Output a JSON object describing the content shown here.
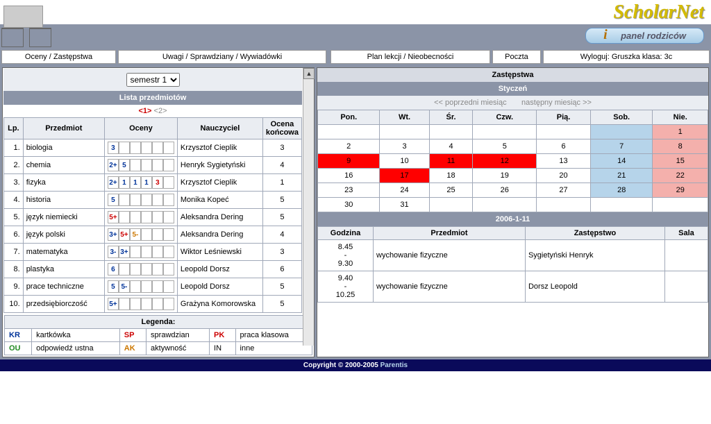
{
  "brand": {
    "name": "ScholarNet",
    "subtitle": "panel rodziców"
  },
  "nav": {
    "grades": "Oceny / Zastępstwa",
    "notes": "Uwagi / Sprawdziany / Wywiadówki",
    "plan": "Plan lekcji / Nieobecności",
    "mail": "Poczta",
    "logout": "Wyloguj: Gruszka klasa: 3c"
  },
  "left": {
    "semester_label": "semestr 1",
    "list_title": "Lista przedmiotów",
    "pager_active": "<1>",
    "pager_inactive": "<2>",
    "headers": {
      "lp": "Lp.",
      "subject": "Przedmiot",
      "grades": "Oceny",
      "teacher": "Nauczyciel",
      "final": "Ocena końcowa"
    },
    "rows": [
      {
        "lp": "1.",
        "subject": "biologia",
        "grades": [
          {
            "v": "3",
            "c": "blue"
          }
        ],
        "teacher": "Krzysztof Cieplik",
        "final": "3"
      },
      {
        "lp": "2.",
        "subject": "chemia",
        "grades": [
          {
            "v": "2+",
            "c": "blue"
          },
          {
            "v": "5",
            "c": "blue"
          }
        ],
        "teacher": "Henryk Sygietyński",
        "final": "4"
      },
      {
        "lp": "3.",
        "subject": "fizyka",
        "grades": [
          {
            "v": "2+",
            "c": "blue"
          },
          {
            "v": "1",
            "c": "blue"
          },
          {
            "v": "1",
            "c": "blue"
          },
          {
            "v": "1",
            "c": "blue"
          },
          {
            "v": "3",
            "c": "red"
          }
        ],
        "teacher": "Krzysztof Cieplik",
        "final": "1"
      },
      {
        "lp": "4.",
        "subject": "historia",
        "grades": [
          {
            "v": "5",
            "c": "blue"
          }
        ],
        "teacher": "Monika Kopeć",
        "final": "5"
      },
      {
        "lp": "5.",
        "subject": "język niemiecki",
        "grades": [
          {
            "v": "5+",
            "c": "red"
          }
        ],
        "teacher": "Aleksandra Dering",
        "final": "5"
      },
      {
        "lp": "6.",
        "subject": "język polski",
        "grades": [
          {
            "v": "3+",
            "c": "blue"
          },
          {
            "v": "5+",
            "c": "red"
          },
          {
            "v": "5-",
            "c": "orange"
          }
        ],
        "teacher": "Aleksandra Dering",
        "final": "4"
      },
      {
        "lp": "7.",
        "subject": "matematyka",
        "grades": [
          {
            "v": "3-",
            "c": "blue"
          },
          {
            "v": "3+",
            "c": "blue"
          }
        ],
        "teacher": "Wiktor Leśniewski",
        "final": "3"
      },
      {
        "lp": "8.",
        "subject": "plastyka",
        "grades": [
          {
            "v": "6",
            "c": "blue"
          }
        ],
        "teacher": "Leopold Dorsz",
        "final": "6"
      },
      {
        "lp": "9.",
        "subject": "prace techniczne",
        "grades": [
          {
            "v": "5",
            "c": "blue"
          },
          {
            "v": "5-",
            "c": "blue"
          }
        ],
        "teacher": "Leopold Dorsz",
        "final": "5"
      },
      {
        "lp": "10.",
        "subject": "przedsiębiorczość",
        "grades": [
          {
            "v": "5+",
            "c": "blue"
          }
        ],
        "teacher": "Grażyna Komorowska",
        "final": "5"
      }
    ],
    "legend_title": "Legenda:",
    "legend": {
      "kr": {
        "code": "KR",
        "label": "kartkówka"
      },
      "ou": {
        "code": "OU",
        "label": "odpowiedź ustna"
      },
      "sp": {
        "code": "SP",
        "label": "sprawdzian"
      },
      "ak": {
        "code": "AK",
        "label": "aktywność"
      },
      "pk": {
        "code": "PK",
        "label": "praca klasowa"
      },
      "in": {
        "code": "IN",
        "label": "inne"
      }
    }
  },
  "right": {
    "title": "Zastępstwa",
    "month": "Styczeń",
    "prev": "<< poprzedni miesiąc",
    "next": "następny miesiąc >>",
    "days": {
      "mon": "Pon.",
      "tue": "Wt.",
      "wed": "Śr.",
      "thu": "Czw.",
      "fri": "Pią.",
      "sat": "Sob.",
      "sun": "Nie."
    },
    "calendar": [
      [
        {
          "v": ""
        },
        {
          "v": ""
        },
        {
          "v": ""
        },
        {
          "v": ""
        },
        {
          "v": ""
        },
        {
          "v": "",
          "cls": "sat"
        },
        {
          "v": "1",
          "cls": "sun"
        }
      ],
      [
        {
          "v": "2"
        },
        {
          "v": "3"
        },
        {
          "v": "4"
        },
        {
          "v": "5"
        },
        {
          "v": "6"
        },
        {
          "v": "7",
          "cls": "sat"
        },
        {
          "v": "8",
          "cls": "sun"
        }
      ],
      [
        {
          "v": "9",
          "cls": "red"
        },
        {
          "v": "10"
        },
        {
          "v": "11",
          "cls": "red"
        },
        {
          "v": "12",
          "cls": "red"
        },
        {
          "v": "13"
        },
        {
          "v": "14",
          "cls": "sat"
        },
        {
          "v": "15",
          "cls": "sun"
        }
      ],
      [
        {
          "v": "16"
        },
        {
          "v": "17",
          "cls": "red"
        },
        {
          "v": "18"
        },
        {
          "v": "19"
        },
        {
          "v": "20"
        },
        {
          "v": "21",
          "cls": "sat"
        },
        {
          "v": "22",
          "cls": "sun"
        }
      ],
      [
        {
          "v": "23"
        },
        {
          "v": "24"
        },
        {
          "v": "25"
        },
        {
          "v": "26"
        },
        {
          "v": "27"
        },
        {
          "v": "28",
          "cls": "sat"
        },
        {
          "v": "29",
          "cls": "sun"
        }
      ],
      [
        {
          "v": "30"
        },
        {
          "v": "31"
        },
        {
          "v": ""
        },
        {
          "v": ""
        },
        {
          "v": ""
        },
        {
          "v": ""
        },
        {
          "v": ""
        }
      ]
    ],
    "selected_date": "2006-1-11",
    "sched_headers": {
      "hour": "Godzina",
      "subject": "Przedmiot",
      "sub": "Zastępstwo",
      "room": "Sala"
    },
    "schedule": [
      {
        "time": "8.45\n-\n9.30",
        "subject": "wychowanie fizyczne",
        "sub": "Sygietyński Henryk",
        "room": ""
      },
      {
        "time": "9.40\n-\n10.25",
        "subject": "wychowanie fizyczne",
        "sub": "Dorsz Leopold",
        "room": ""
      }
    ]
  },
  "footer": {
    "copyright": "Copyright © 2000-2005 ",
    "link": "Parentis"
  }
}
